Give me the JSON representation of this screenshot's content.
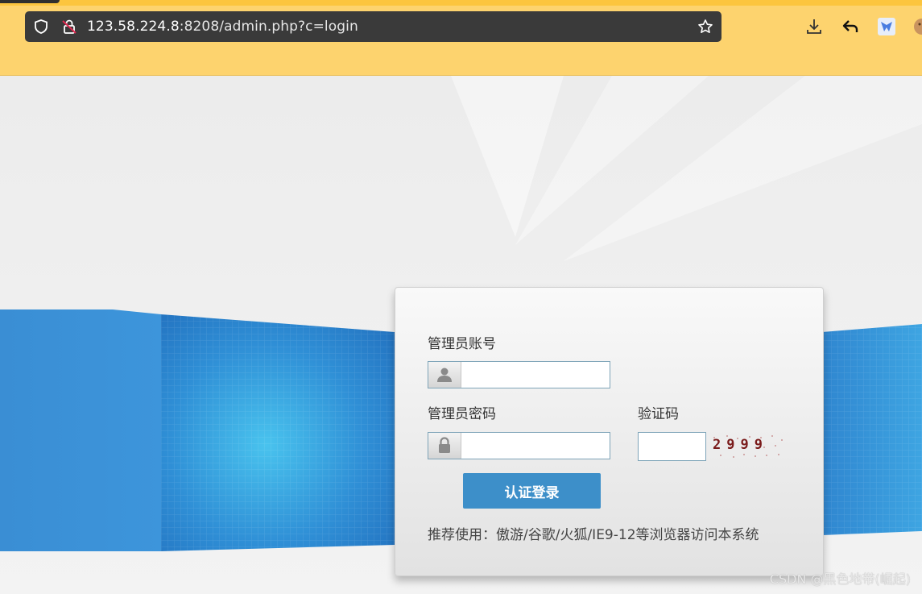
{
  "browser": {
    "url_host": "123.58.224.8",
    "url_rest": ":8208/admin.php?c=login",
    "icons": [
      "shield-icon",
      "lock-insecure-icon",
      "star-icon",
      "download-icon",
      "back-icon",
      "extension-icon",
      "cookie-icon"
    ]
  },
  "login": {
    "username_label": "管理员账号",
    "password_label": "管理员密码",
    "captcha_label": "验证码",
    "captcha_image_text": "2999",
    "submit_label": "认证登录",
    "hint": "推荐使用：傲游/谷歌/火狐/IE9-12等浏览器访问本系统",
    "username_value": "",
    "password_value": "",
    "captcha_value": ""
  },
  "watermark": "CSDN @黑色地带(崛起)",
  "colors": {
    "accent": "#3d8fc9",
    "chrome": "#fdd36e",
    "captcha": "#7a1b1b"
  }
}
